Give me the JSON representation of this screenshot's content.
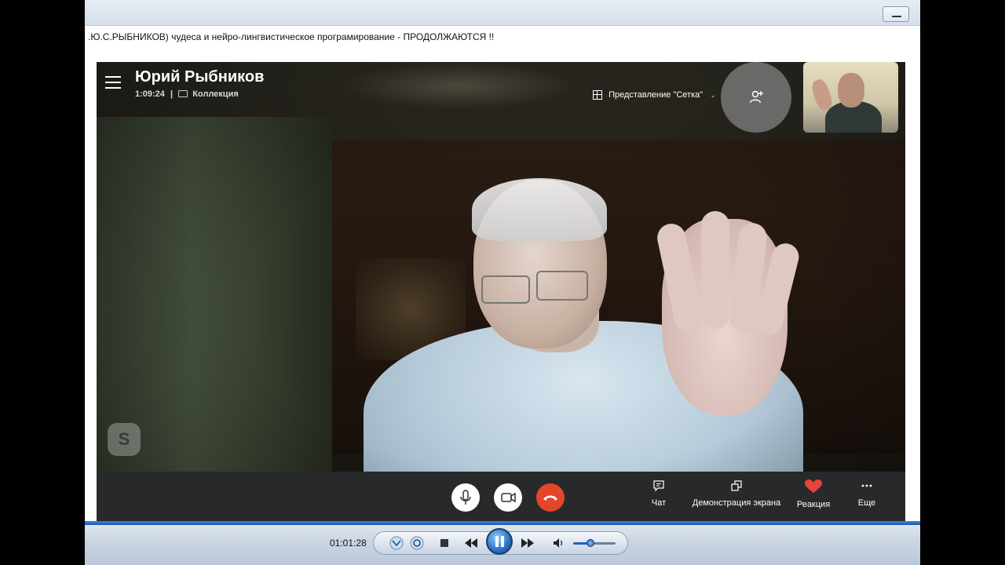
{
  "video_caption": ".Ю.С.РЫБНИКОВ) чудеса и нейро-лингвистическое програмирование - ПРОДОЛЖАЮТСЯ !!",
  "call": {
    "caller_name": "Юрий Рыбников",
    "duration": "1:09:24",
    "separator": "|",
    "collection_label": "Коллекция",
    "view_mode_label": "Представление \"Сетка\"",
    "logo_letter": "S"
  },
  "call_controls": {
    "chat_label": "Чат",
    "share_screen_label": "Демонстрация экрана",
    "reaction_label": "Реакция",
    "more_label": "Еще",
    "hangup_color": "#e4462b",
    "reaction_color": "#e8423b"
  },
  "player": {
    "current_time": "01:01:28",
    "volume_level": 0.4,
    "state": "playing"
  }
}
